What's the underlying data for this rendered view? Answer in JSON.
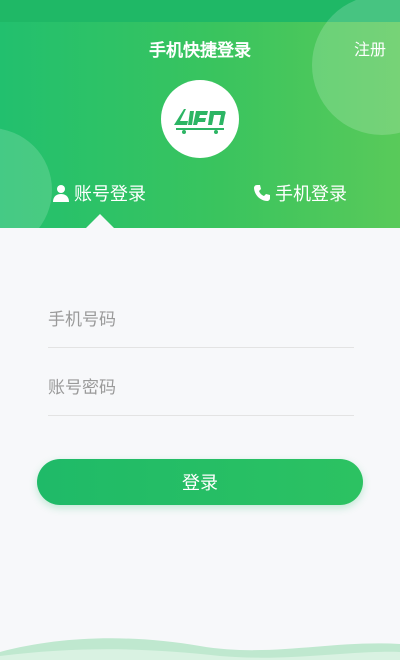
{
  "header": {
    "title": "手机快捷登录",
    "register_label": "注册",
    "logo_icon": "app-logo-icon",
    "colors": {
      "primary": "#22c06e",
      "primary_light": "#59ca5a"
    }
  },
  "tabs": [
    {
      "label": "账号登录",
      "icon": "user-icon",
      "active": true
    },
    {
      "label": "手机登录",
      "icon": "phone-icon",
      "active": false
    }
  ],
  "form": {
    "phone_placeholder": "手机号码",
    "password_placeholder": "账号密码",
    "login_label": "登录"
  }
}
